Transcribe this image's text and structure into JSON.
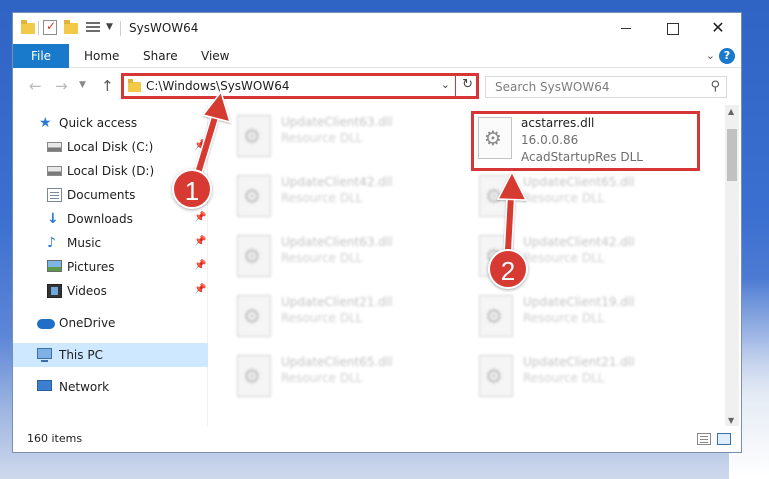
{
  "window": {
    "title": "SysWOW64"
  },
  "ribbon": {
    "file": "File",
    "home": "Home",
    "share": "Share",
    "view": "View"
  },
  "navbar": {
    "address": "C:\\Windows\\SysWOW64",
    "search_placeholder": "Search SysWOW64"
  },
  "sidebar": {
    "items": [
      {
        "label": "Quick access",
        "icon": "star-icon",
        "pinned": false
      },
      {
        "label": "Local Disk (C:)",
        "icon": "disk-icon",
        "pinned": true
      },
      {
        "label": "Local Disk (D:)",
        "icon": "disk-icon",
        "pinned": false
      },
      {
        "label": "Documents",
        "icon": "documents-icon",
        "pinned": true
      },
      {
        "label": "Downloads",
        "icon": "download-icon",
        "pinned": true
      },
      {
        "label": "Music",
        "icon": "music-icon",
        "pinned": true
      },
      {
        "label": "Pictures",
        "icon": "pictures-icon",
        "pinned": true
      },
      {
        "label": "Videos",
        "icon": "videos-icon",
        "pinned": true
      },
      {
        "label": "OneDrive",
        "icon": "cloud-icon",
        "pinned": false
      },
      {
        "label": "This PC",
        "icon": "computer-icon",
        "pinned": false,
        "selected": true
      },
      {
        "label": "Network",
        "icon": "network-icon",
        "pinned": false
      }
    ]
  },
  "files": {
    "left": [
      {
        "name": "UpdateClient63.dll",
        "type": "Resource DLL"
      },
      {
        "name": "UpdateClient42.dll",
        "type": "Resource DLL"
      },
      {
        "name": "UpdateClient63.dll",
        "type": "Resource DLL"
      },
      {
        "name": "UpdateClient21.dll",
        "type": "Resource DLL"
      },
      {
        "name": "UpdateClient65.dll",
        "type": "Resource DLL"
      }
    ],
    "right": [
      {
        "name": "UpdateClient65.dll",
        "type": "Resource DLL"
      },
      {
        "name": "UpdateClient42.dll",
        "type": "Resource DLL"
      },
      {
        "name": "UpdateClient19.dll",
        "type": "Resource DLL"
      },
      {
        "name": "UpdateClient21.dll",
        "type": "Resource DLL"
      }
    ],
    "selected": {
      "name": "acstarres.dll",
      "version": "16.0.0.86",
      "type": "AcadStartupRes DLL"
    }
  },
  "status": {
    "items_count": "160 items"
  },
  "markers": {
    "one": "1",
    "two": "2"
  },
  "colors": {
    "accent": "#1979ca",
    "highlight_red": "#d63636",
    "selected_nav": "#cde8ff"
  }
}
